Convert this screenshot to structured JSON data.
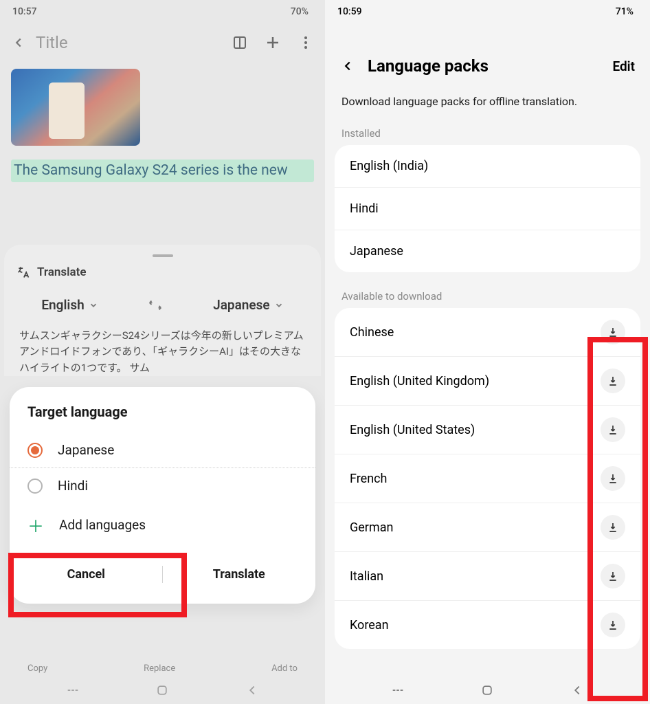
{
  "left": {
    "status": {
      "time": "10:57",
      "battery": "70%"
    },
    "header": {
      "title": "Title"
    },
    "body_text": "The Samsung Galaxy S24 series is the new",
    "translate": {
      "label": "Translate",
      "source": "English",
      "target": "Japanese",
      "translated": "サムスンギャラクシーS24シリーズは今年の新しいプレミアムアンドロイドフォンであり、「ギャラクシーAI」はその大きなハイライトの1つです。 サム"
    },
    "dialog": {
      "title": "Target language",
      "options": [
        "Japanese",
        "Hindi"
      ],
      "add": "Add languages",
      "cancel": "Cancel",
      "translate": "Translate"
    },
    "cropped": {
      "a": "Copy",
      "b": "Replace",
      "c": "Add to"
    }
  },
  "right": {
    "status": {
      "time": "10:59",
      "battery": "71%"
    },
    "header": {
      "title": "Language packs",
      "edit": "Edit"
    },
    "subtitle": "Download language packs for offline translation.",
    "installed_label": "Installed",
    "installed": [
      "English (India)",
      "Hindi",
      "Japanese"
    ],
    "available_label": "Available to download",
    "available": [
      "Chinese",
      "English (United Kingdom)",
      "English (United States)",
      "French",
      "German",
      "Italian",
      "Korean"
    ]
  }
}
